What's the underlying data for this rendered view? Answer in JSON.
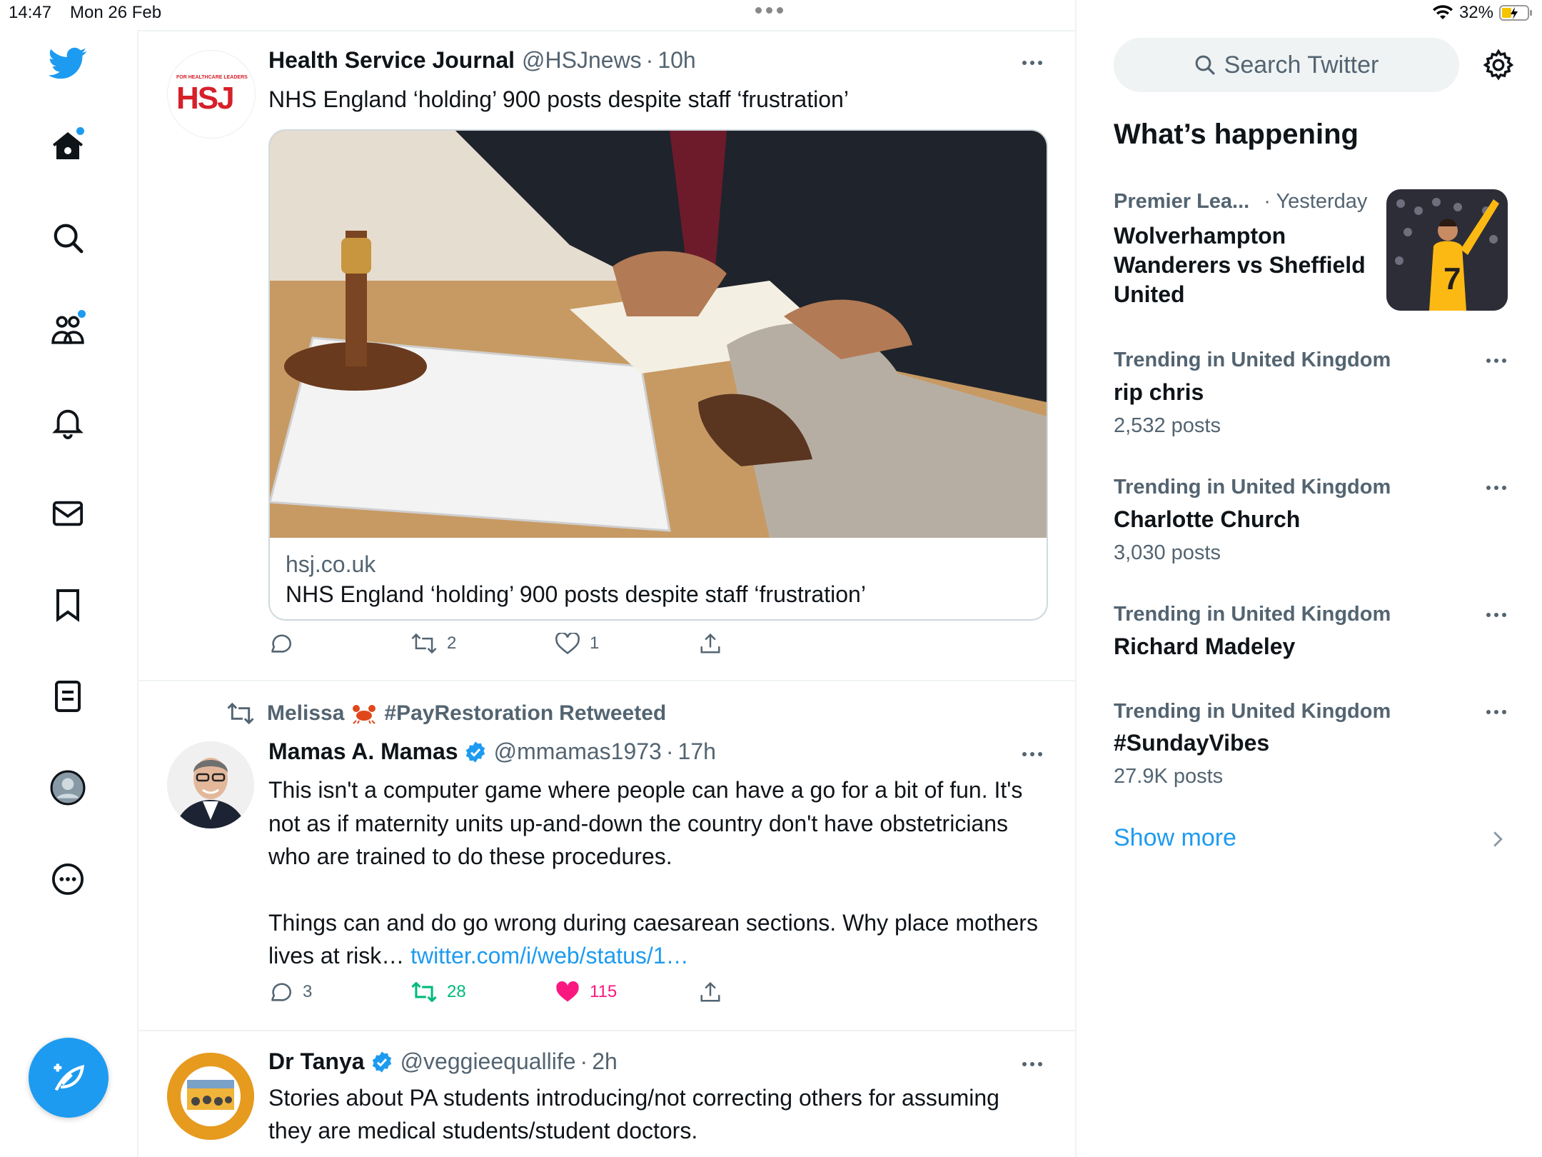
{
  "status_bar": {
    "time": "14:47",
    "date": "Mon 26 Feb",
    "battery": "32%"
  },
  "nav": {
    "items": [
      "twitter-logo",
      "home",
      "explore",
      "communities",
      "notifications",
      "messages",
      "bookmarks",
      "lists",
      "profile",
      "more"
    ]
  },
  "tweets": [
    {
      "name": "Health Service Journal",
      "handle": "@HSJnews",
      "time": "10h",
      "text": "NHS England ‘holding’ 900 posts despite staff ‘frustration’",
      "avatar_text": "HSJ",
      "avatar_tag": "FOR HEALTHCARE LEADERS",
      "card": {
        "domain": "hsj.co.uk",
        "title": "NHS England ‘holding’ 900 posts despite staff ‘frustration’"
      },
      "stats": {
        "replies": "",
        "retweets": "2",
        "likes": "1"
      }
    },
    {
      "retweeted_by": "Melissa",
      "retweeted_by_tag": "#PayRestoration",
      "retweeted_label": "Retweeted",
      "name": "Mamas A. Mamas",
      "handle": "@mmamas1973",
      "time": "17h",
      "text_p1": "This isn't a computer game where people can have a go for a bit of fun. It's not as if maternity units up-and-down the country don't have obstetricians who are trained to do these procedures.",
      "text_p2": "Things can and do go wrong during caesarean sections. Why place mothers lives at risk…",
      "link": "twitter.com/i/web/status/1…",
      "stats": {
        "replies": "3",
        "retweets": "28",
        "likes": "115"
      }
    },
    {
      "name": "Dr Tanya",
      "handle": "@veggieequallife",
      "time": "2h",
      "text": "Stories about PA students introducing/not correcting others for assuming they are medical students/student doctors."
    }
  ],
  "sidebar": {
    "search_placeholder": "Search Twitter",
    "title": "What’s happening",
    "featured": {
      "category": "Premier Lea...",
      "time": "· Yesterday",
      "headline": "Wolverhampton Wanderers vs Sheffield United",
      "thumb_number": "7"
    },
    "trends": [
      {
        "meta": "Trending in United Kingdom",
        "name": "rip chris",
        "count": "2,532 posts"
      },
      {
        "meta": "Trending in United Kingdom",
        "name": "Charlotte Church",
        "count": "3,030 posts"
      },
      {
        "meta": "Trending in United Kingdom",
        "name": "Richard Madeley",
        "count": ""
      },
      {
        "meta": "Trending in United Kingdom",
        "name": "#SundayVibes",
        "count": "27.9K posts"
      }
    ],
    "show_more": "Show more"
  },
  "colors": {
    "accent": "#1d9bf0",
    "like": "#f91880",
    "retweet": "#00ba7c",
    "text": "#0f1419",
    "secondary": "#536471"
  }
}
